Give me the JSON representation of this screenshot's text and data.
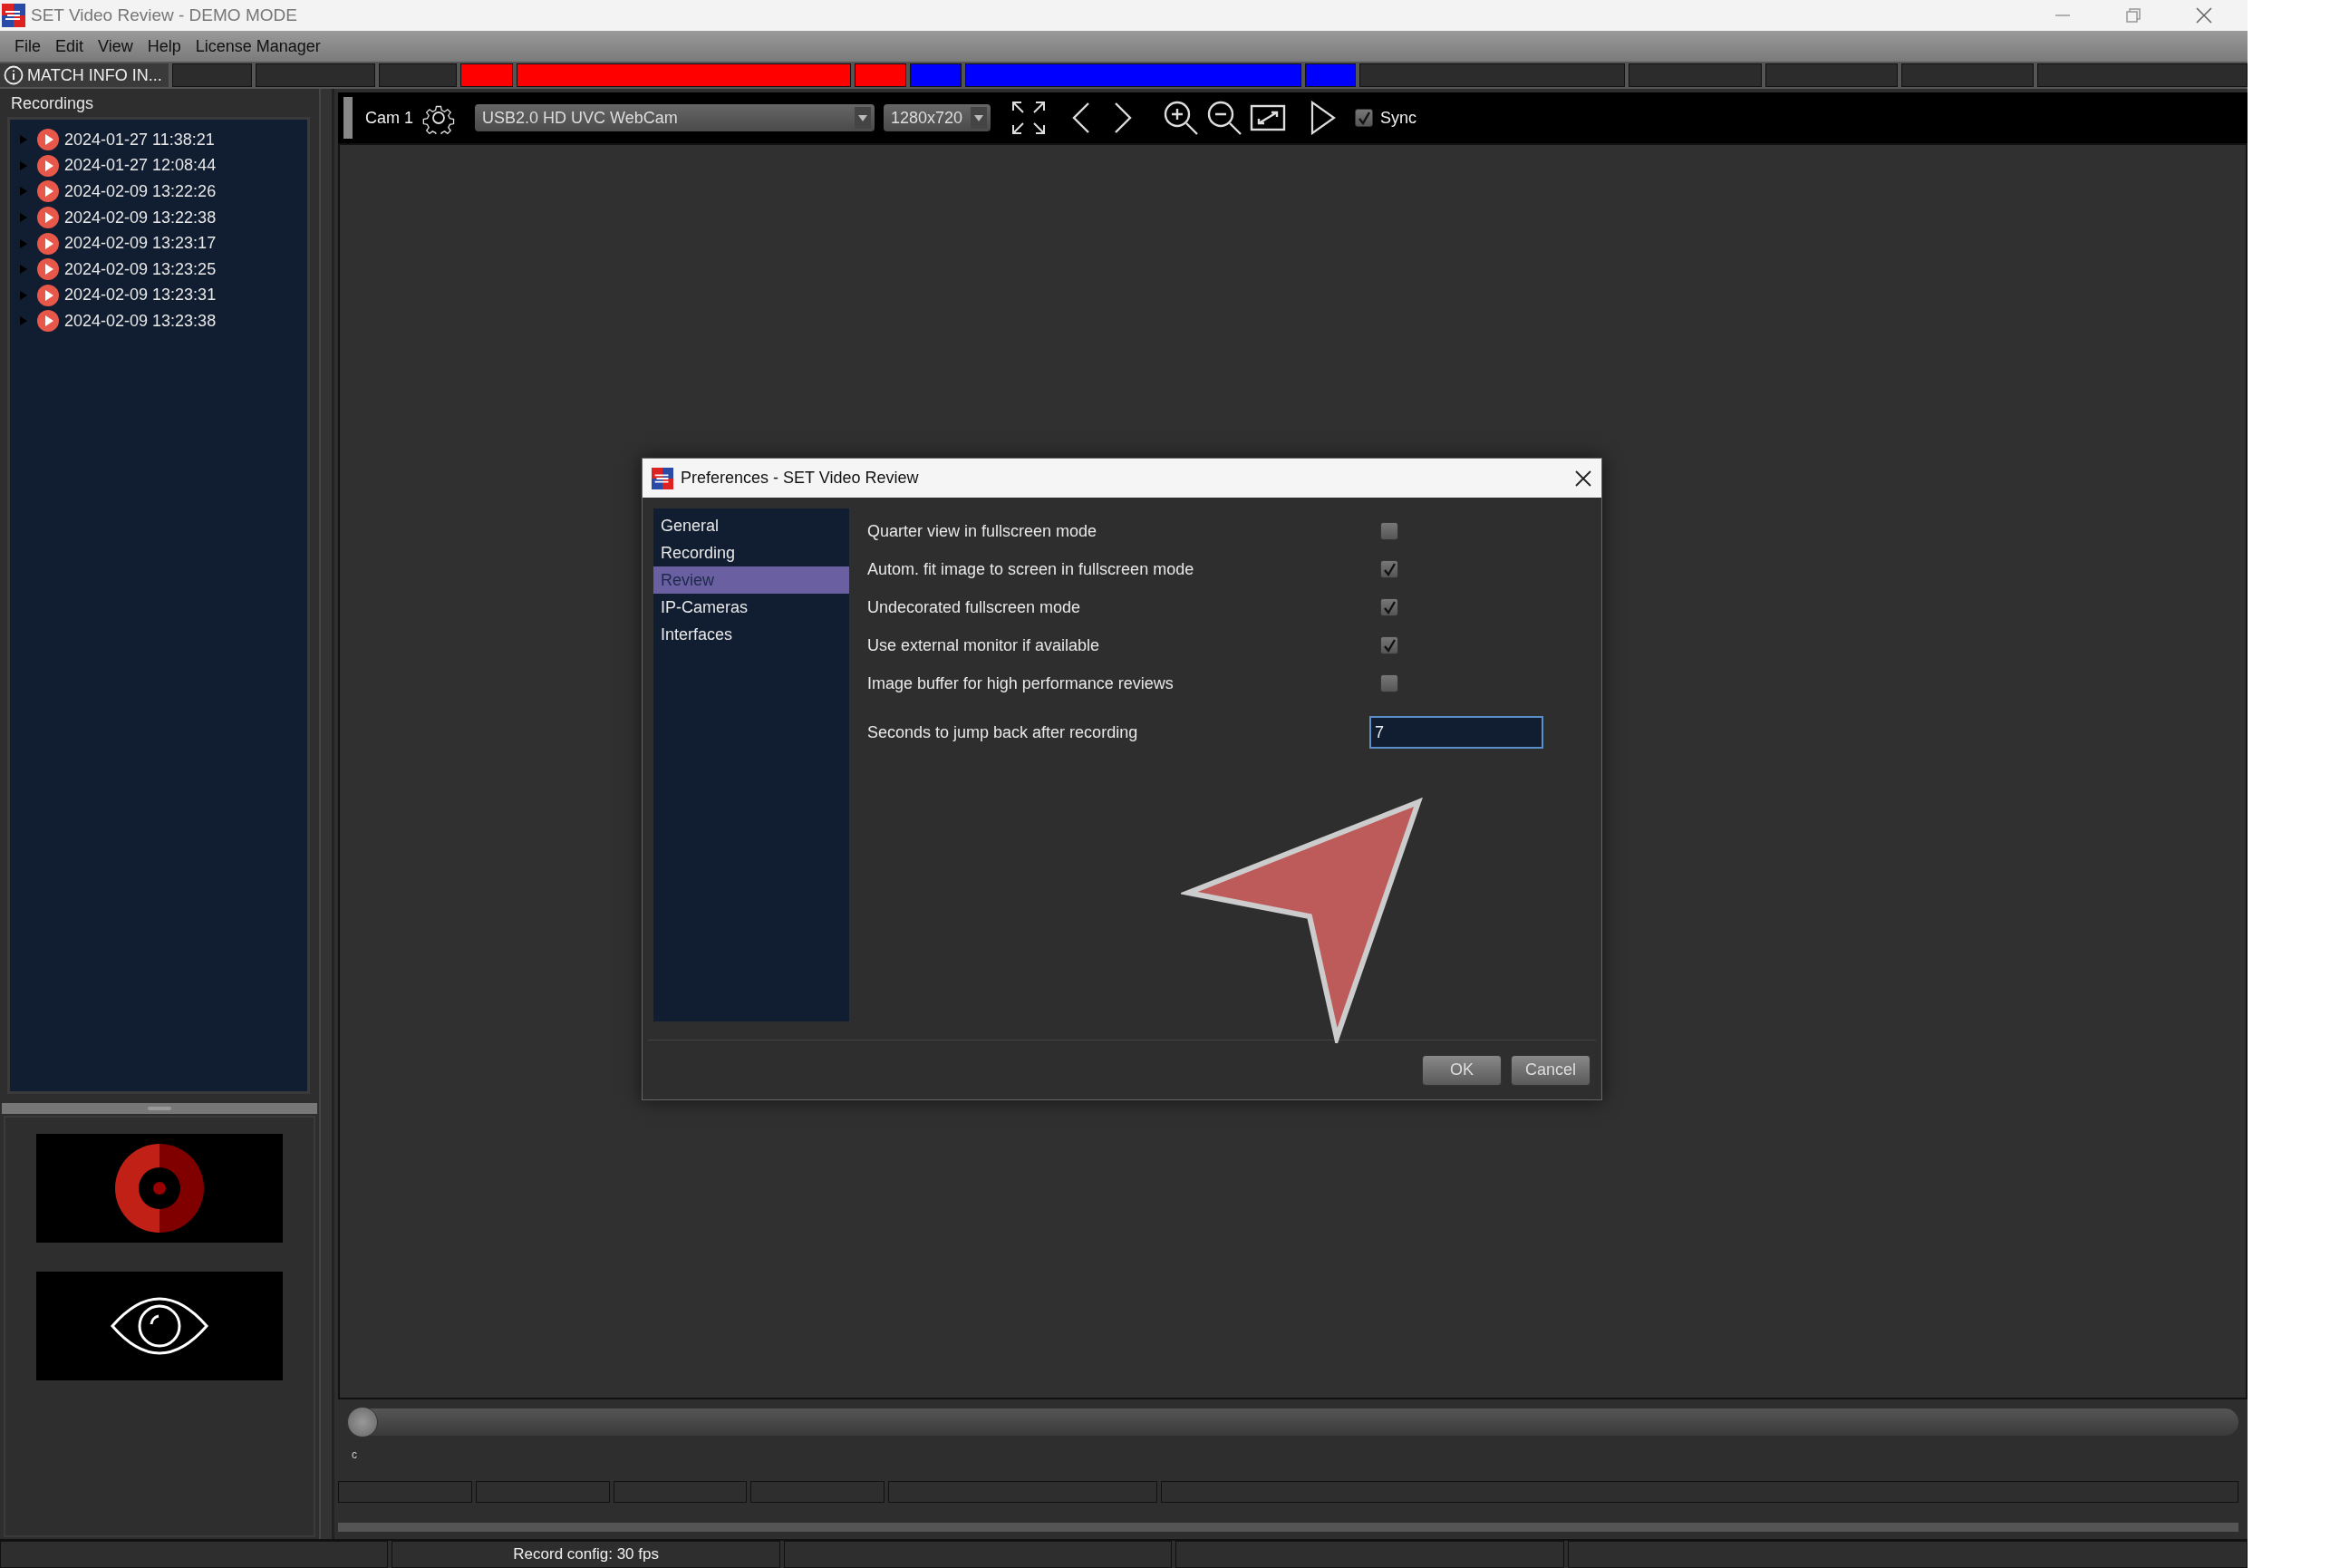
{
  "window": {
    "title": "SET Video Review - DEMO MODE"
  },
  "menu": [
    "File",
    "Edit",
    "View",
    "Help",
    "License Manager"
  ],
  "match_bar": {
    "info_label": "MATCH INFO IN...",
    "segments": [
      {
        "color": "#2c2c2c"
      },
      {
        "color": "#2c2c2c"
      },
      {
        "color": "#2c2c2c"
      },
      {
        "color": "#ff0000"
      },
      {
        "color": "#ff0000"
      },
      {
        "color": "#ff0000"
      },
      {
        "color": "#0000ff"
      },
      {
        "color": "#0000ff"
      },
      {
        "color": "#0000ff"
      },
      {
        "color": "#2c2c2c"
      },
      {
        "color": "#2c2c2c"
      },
      {
        "color": "#2c2c2c"
      },
      {
        "color": "#2c2c2c"
      },
      {
        "color": "#2c2c2c"
      }
    ]
  },
  "sidebar": {
    "title": "Recordings",
    "items": [
      {
        "label": "2024-01-27 11:38:21",
        "expanded": false
      },
      {
        "label": "2024-01-27 12:08:44",
        "expanded": false
      },
      {
        "label": "2024-02-09 13:22:26",
        "expanded": false
      },
      {
        "label": "2024-02-09 13:22:38",
        "expanded": false
      },
      {
        "label": "2024-02-09 13:23:17",
        "expanded": false
      },
      {
        "label": "2024-02-09 13:23:25",
        "expanded": false
      },
      {
        "label": "2024-02-09 13:23:31",
        "expanded": false
      },
      {
        "label": "2024-02-09 13:23:38",
        "expanded": false
      }
    ]
  },
  "toolbar": {
    "camera_label": "Cam 1",
    "camera": "USB2.0 HD UVC WebCam",
    "resolution": "1280x720",
    "sync": {
      "label": "Sync",
      "checked": true
    }
  },
  "timeline": {
    "tick_label": "c",
    "level": 0
  },
  "dialog": {
    "title": "Preferences - SET Video Review",
    "nav": [
      {
        "label": "General",
        "selected": false
      },
      {
        "label": "Recording",
        "selected": false
      },
      {
        "label": "Review",
        "selected": true
      },
      {
        "label": "IP-Cameras",
        "selected": false
      },
      {
        "label": "Interfaces",
        "selected": false
      }
    ],
    "settings": [
      {
        "kind": "checkbox",
        "label": "Quarter view in fullscreen mode",
        "checked": false
      },
      {
        "kind": "checkbox",
        "label": "Autom. fit image to screen in fullscreen mode",
        "checked": true
      },
      {
        "kind": "checkbox",
        "label": "Undecorated fullscreen mode",
        "checked": true
      },
      {
        "kind": "checkbox",
        "label": "Use external monitor if available",
        "checked": true
      },
      {
        "kind": "checkbox",
        "label": "Image buffer for high performance reviews",
        "checked": false
      },
      {
        "kind": "number",
        "label": "Seconds to jump back after recording",
        "value": "7"
      }
    ],
    "buttons": [
      "OK",
      "Cancel"
    ]
  },
  "status_bar": {
    "record_config": "Record config: 30 fps"
  }
}
